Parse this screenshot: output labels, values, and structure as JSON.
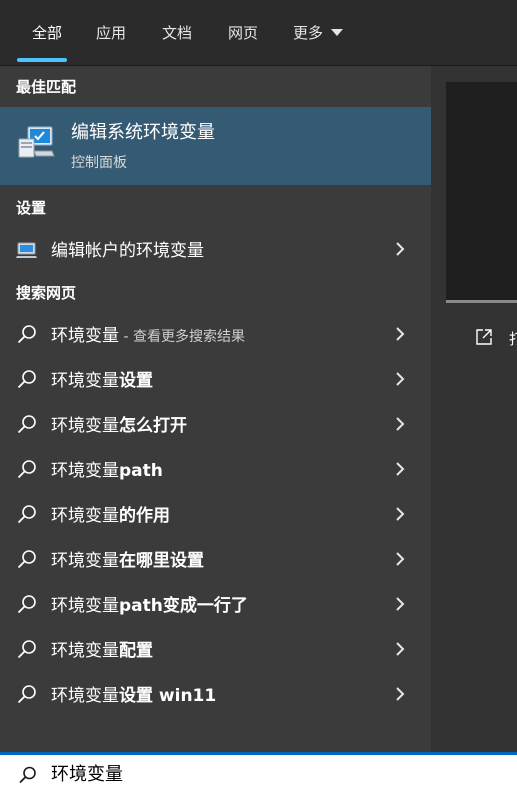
{
  "tabs": [
    {
      "label": "全部",
      "active": true
    },
    {
      "label": "应用"
    },
    {
      "label": "文档"
    },
    {
      "label": "网页"
    },
    {
      "label": "更多"
    }
  ],
  "best_match": {
    "section": "最佳匹配",
    "title": "编辑系统环境变量",
    "subtitle": "控制面板",
    "icon": "system-properties-icon"
  },
  "settings": {
    "section": "设置",
    "item": {
      "label": "编辑帐户的环境变量",
      "icon": "settings-monitor-icon"
    }
  },
  "web": {
    "section": "搜索网页",
    "items": [
      {
        "prefix": "环境变量",
        "bold": "",
        "dim": " - 查看更多搜索结果"
      },
      {
        "prefix": "环境变量",
        "bold": "设置",
        "dim": ""
      },
      {
        "prefix": "环境变量",
        "bold": "怎么打开",
        "dim": ""
      },
      {
        "prefix": "环境变量",
        "bold": "path",
        "dim": ""
      },
      {
        "prefix": "环境变量",
        "bold": "的作用",
        "dim": ""
      },
      {
        "prefix": "环境变量",
        "bold": "在哪里设置",
        "dim": ""
      },
      {
        "prefix": "环境变量",
        "bold": "path变成一行了",
        "dim": ""
      },
      {
        "prefix": "环境变量",
        "bold": "配置",
        "dim": ""
      },
      {
        "prefix": "环境变量",
        "bold": "设置 win11",
        "dim": ""
      }
    ]
  },
  "preview": {
    "open_label": "打"
  },
  "search": {
    "value": "环境变量"
  },
  "colors": {
    "accent": "#4cc2ff",
    "selected_row": "#355a73",
    "search_border": "#0067c0"
  }
}
